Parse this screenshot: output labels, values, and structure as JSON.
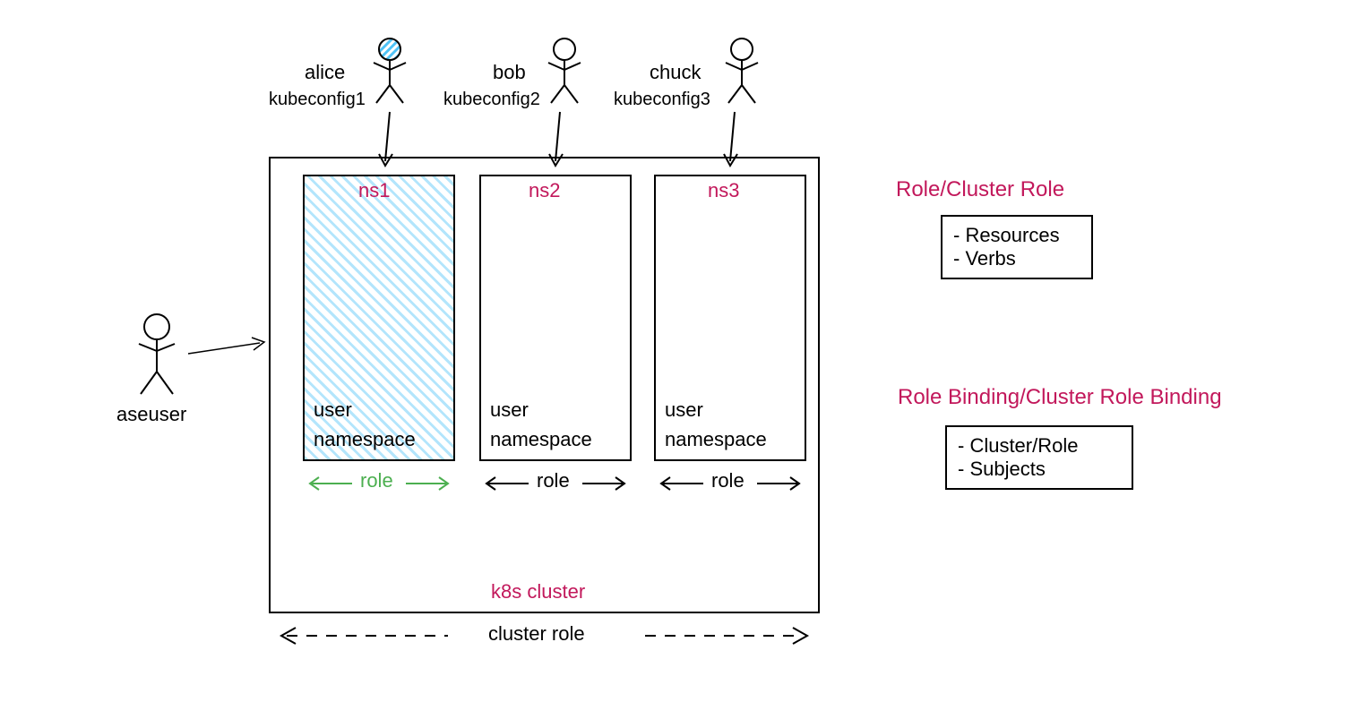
{
  "users": {
    "alice": {
      "name": "alice",
      "config": "kubeconfig1"
    },
    "bob": {
      "name": "bob",
      "config": "kubeconfig2"
    },
    "chuck": {
      "name": "chuck",
      "config": "kubeconfig3"
    },
    "aseuser": {
      "name": "aseuser"
    }
  },
  "namespaces": {
    "ns1": {
      "title": "ns1",
      "line1": "user",
      "line2": "namespace",
      "role_label": "role"
    },
    "ns2": {
      "title": "ns2",
      "line1": "user",
      "line2": "namespace",
      "role_label": "role"
    },
    "ns3": {
      "title": "ns3",
      "line1": "user",
      "line2": "namespace",
      "role_label": "role"
    }
  },
  "cluster": {
    "label": "k8s cluster",
    "cluster_role_label": "cluster role"
  },
  "side_panel": {
    "role_title": "Role/Cluster Role",
    "role_items": {
      "a": "- Resources",
      "b": "- Verbs"
    },
    "binding_title": "Role Binding/Cluster Role Binding",
    "binding_items": {
      "a": "- Cluster/Role",
      "b": "- Subjects"
    }
  }
}
